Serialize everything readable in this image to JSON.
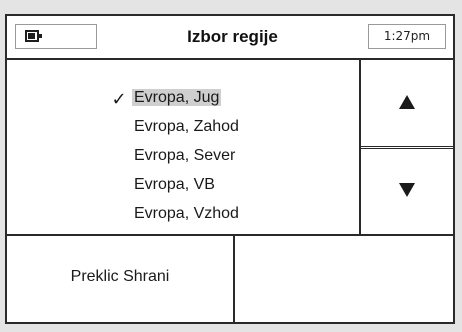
{
  "titlebar": {
    "title": "Izbor regije",
    "clock": "1:27pm",
    "battery_icon": "battery-icon"
  },
  "list": {
    "selected_index": 0,
    "check_icon": "checkmark-icon",
    "check_glyph": "✓",
    "items": [
      {
        "label": "Evropa, Jug"
      },
      {
        "label": "Evropa, Zahod"
      },
      {
        "label": "Evropa, Sever"
      },
      {
        "label": "Evropa, VB"
      },
      {
        "label": "Evropa, Vzhod"
      }
    ]
  },
  "scroll": {
    "up_icon": "arrow-up-icon",
    "down_icon": "arrow-down-icon"
  },
  "softkeys": {
    "left_label": "Preklic Shrani",
    "right_label": ""
  },
  "colors": {
    "frame": "#2a2a2a",
    "background": "#ffffff",
    "selection_highlight": "#cfcfcf",
    "outer_background": "#e4e4e4"
  }
}
